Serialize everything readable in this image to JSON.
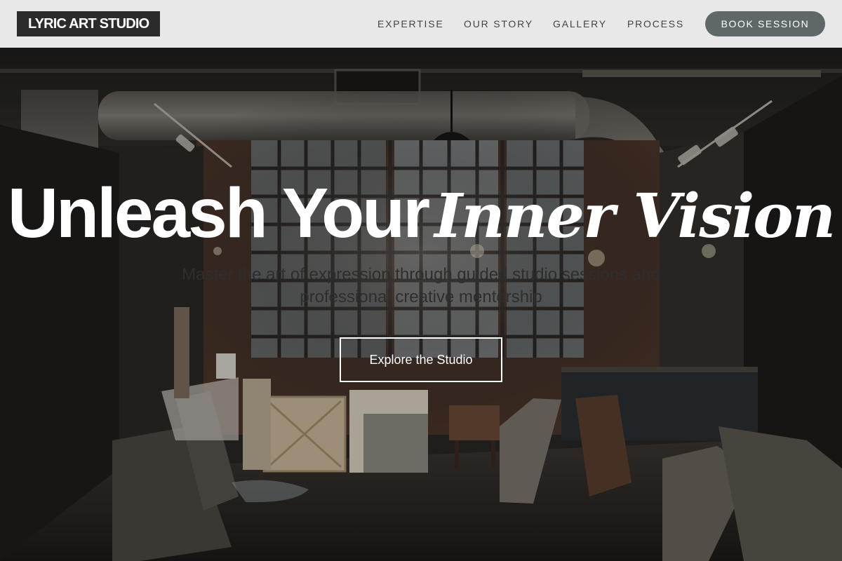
{
  "brand": {
    "logo_text": "LYRIC ART STUDIO"
  },
  "nav": {
    "items": [
      {
        "label": "EXPERTISE"
      },
      {
        "label": "OUR STORY"
      },
      {
        "label": "GALLERY"
      },
      {
        "label": "PROCESS"
      }
    ],
    "cta_label": "BOOK SESSION"
  },
  "hero": {
    "headline_plain": "Unleash Your",
    "headline_accent": "Inner Vision",
    "subtitle": "Master the art of expression through guided studio sessions and professional creative mentorship",
    "cta_label": "Explore the Studio",
    "background": "art-studio-loft-photo"
  },
  "colors": {
    "header_bg": "#e8e8e8",
    "logo_bg": "#2b2b2b",
    "nav_text": "#444444",
    "book_button_bg": "#5f6868",
    "hero_text": "#ffffff"
  }
}
